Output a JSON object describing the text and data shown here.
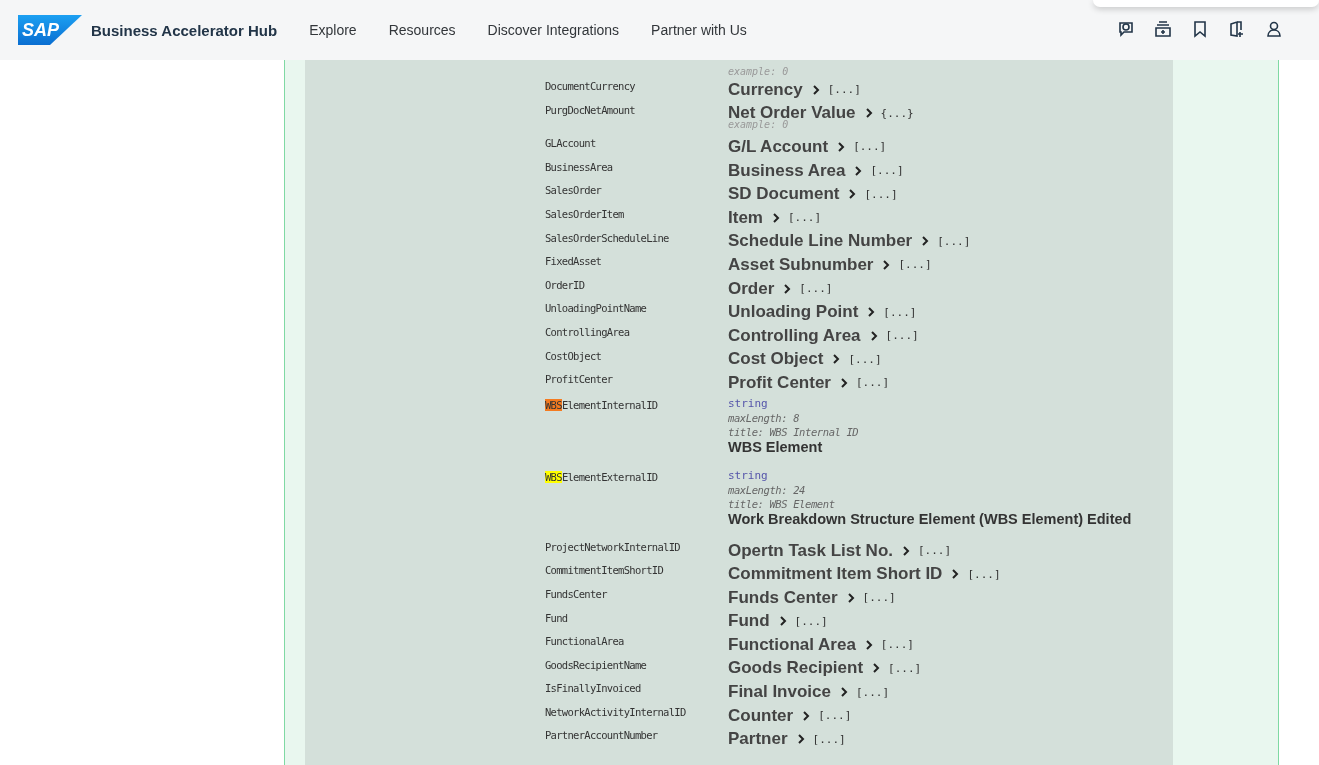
{
  "header": {
    "logo": "SAP",
    "title": "Business Accelerator Hub",
    "nav": [
      "Explore",
      "Resources",
      "Discover Integrations",
      "Partner with Us"
    ],
    "icons": [
      {
        "kind": "feedback"
      },
      {
        "kind": "cart"
      },
      {
        "kind": "bookmark"
      },
      {
        "kind": "add-app"
      },
      {
        "kind": "user"
      }
    ]
  },
  "schema": {
    "lead_example": "example: 0",
    "rows": [
      {
        "kind": "ref",
        "name": "DocumentCurrency",
        "title": "Currency",
        "link": "[...]"
      },
      {
        "kind": "ref",
        "name": "PurgDocNetAmount",
        "title": "Net Order Value",
        "link": "{...}",
        "example": "example: 0"
      },
      {
        "kind": "ref",
        "name": "GLAccount",
        "title": "G/L Account",
        "link": "[...]"
      },
      {
        "kind": "ref",
        "name": "BusinessArea",
        "title": "Business Area",
        "link": "[...]"
      },
      {
        "kind": "ref",
        "name": "SalesOrder",
        "title": "SD Document",
        "link": "[...]"
      },
      {
        "kind": "ref",
        "name": "SalesOrderItem",
        "title": "Item",
        "link": "[...]"
      },
      {
        "kind": "ref",
        "name": "SalesOrderScheduleLine",
        "title": "Schedule Line Number",
        "link": "[...]"
      },
      {
        "kind": "ref",
        "name": "FixedAsset",
        "title": "Asset Subnumber",
        "link": "[...]"
      },
      {
        "kind": "ref",
        "name": "OrderID",
        "title": "Order",
        "link": "[...]"
      },
      {
        "kind": "ref",
        "name": "UnloadingPointName",
        "title": "Unloading Point",
        "link": "[...]"
      },
      {
        "kind": "ref",
        "name": "ControllingArea",
        "title": "Controlling Area",
        "link": "[...]"
      },
      {
        "kind": "ref",
        "name": "CostObject",
        "title": "Cost Object",
        "link": "[...]"
      },
      {
        "kind": "ref",
        "name": "ProfitCenter",
        "title": "Profit Center",
        "link": "[...]"
      },
      {
        "kind": "detail",
        "highlight": {
          "text": "WBS",
          "color": "#f47b20"
        },
        "name": "ElementInternalID",
        "type": "string",
        "max_length": "maxLength: 8",
        "field_title": "title: WBS Internal ID",
        "description": "WBS Element"
      },
      {
        "kind": "detail",
        "highlight": {
          "text": "WBS",
          "color": "#ffff00"
        },
        "name": "ElementExternalID",
        "type": "string",
        "max_length": "maxLength: 24",
        "field_title": "title: WBS Element",
        "description": "Work Breakdown Structure Element (WBS Element) Edited"
      },
      {
        "kind": "ref",
        "name": "ProjectNetworkInternalID",
        "title": "Opertn Task List No.",
        "link": "[...]"
      },
      {
        "kind": "ref",
        "name": "CommitmentItemShortID",
        "title": "Commitment Item Short ID",
        "link": "[...]"
      },
      {
        "kind": "ref",
        "name": "FundsCenter",
        "title": "Funds Center",
        "link": "[...]"
      },
      {
        "kind": "ref",
        "name": "Fund",
        "title": "Fund",
        "link": "[...]"
      },
      {
        "kind": "ref",
        "name": "FunctionalArea",
        "title": "Functional Area",
        "link": "[...]"
      },
      {
        "kind": "ref",
        "name": "GoodsRecipientName",
        "title": "Goods Recipient",
        "link": "[...]"
      },
      {
        "kind": "ref",
        "name": "IsFinallyInvoiced",
        "title": "Final Invoice",
        "link": "[...]"
      },
      {
        "kind": "ref",
        "name": "NetworkActivityInternalID",
        "title": "Counter",
        "link": "[...]"
      },
      {
        "kind": "ref",
        "name": "PartnerAccountNumber",
        "title": "Partner",
        "link": "[...]"
      }
    ]
  }
}
